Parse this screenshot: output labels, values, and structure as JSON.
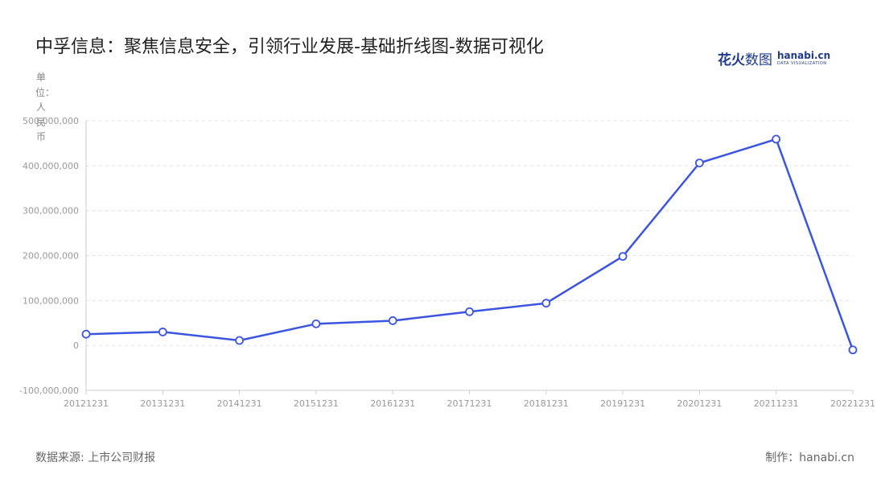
{
  "title": "中孚信息：聚焦信息安全，引领行业发展-基础折线图-数据可视化",
  "brand": {
    "cn_bold": "花火",
    "cn_thin": "数图",
    "en": "hanabi.cn",
    "en_sub": "DATA VISUALIZATION",
    "color": "#1f3a8a"
  },
  "footer": {
    "source": "数据来源: 上市公司财报",
    "maker": "制作：hanabi.cn"
  },
  "colors": {
    "line": "#3b55e0",
    "grid": "#e0e0e0",
    "axis": "#cccccc"
  },
  "chart_data": {
    "type": "line",
    "ylabel": "单位：人民币",
    "categories": [
      "20121231",
      "20131231",
      "20141231",
      "20151231",
      "20161231",
      "20171231",
      "20181231",
      "20191231",
      "20201231",
      "20211231",
      "20221231"
    ],
    "values": [
      25000000,
      30000000,
      11000000,
      48000000,
      55000000,
      75000000,
      94000000,
      198000000,
      406000000,
      459000000,
      -10000000
    ],
    "ylim": [
      -100000000,
      500000000
    ],
    "yticks": [
      -100000000,
      0,
      100000000,
      200000000,
      300000000,
      400000000,
      500000000
    ],
    "ytick_labels": [
      "-100,000,000",
      "0",
      "100,000,000",
      "200,000,000",
      "300,000,000",
      "400,000,000",
      "500,000,000"
    ],
    "grid": true,
    "legend": "none"
  }
}
